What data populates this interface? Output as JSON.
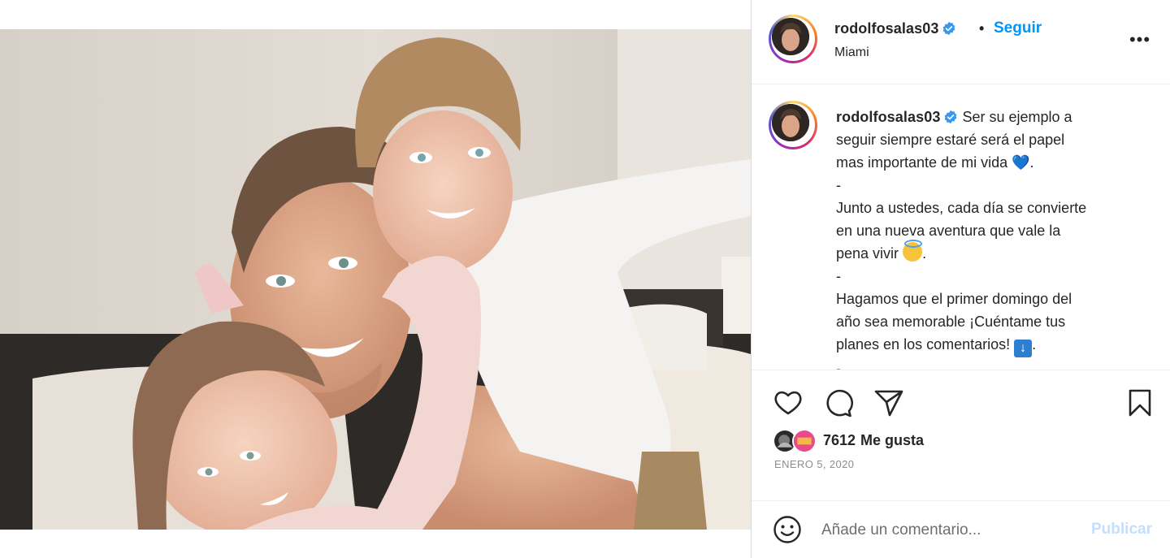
{
  "post": {
    "username": "rodolfosalas03",
    "follow_label": "Seguir",
    "dot": "•",
    "location": "Miami",
    "more_label": "•••",
    "photo_alt": "",
    "icons": {
      "verified": "verified-badge-icon",
      "like": "heart-outline-icon",
      "comment": "comment-bubble-icon",
      "share": "paper-plane-icon",
      "save": "bookmark-icon",
      "emoji": "smiley-icon"
    },
    "colors": {
      "link_blue": "#0095f6",
      "publish_disabled": "#c2e0fd",
      "verified": "#3897f0"
    }
  },
  "caption": {
    "username": "rodolfosalas03",
    "lines": [
      "Ser su ejemplo a",
      "seguir siempre estaré será el papel",
      "mas importante de mi vida",
      "-",
      "Junto a ustedes, cada día se convierte",
      "en una nueva aventura que vale la",
      "pena vivir",
      "-",
      "Hagamos que el primer domingo del",
      "año sea memorable ¡Cuéntame tus",
      "planes en los comentarios!",
      "-"
    ],
    "heart_emoji": "💙",
    "arrow_emoji": "↓",
    "period": "."
  },
  "engagement": {
    "likes_count": "7612",
    "likes_label": "Me gusta",
    "date": "ENERO 5, 2020"
  },
  "comment": {
    "placeholder": "Añade un comentario...",
    "publish_label": "Publicar"
  }
}
